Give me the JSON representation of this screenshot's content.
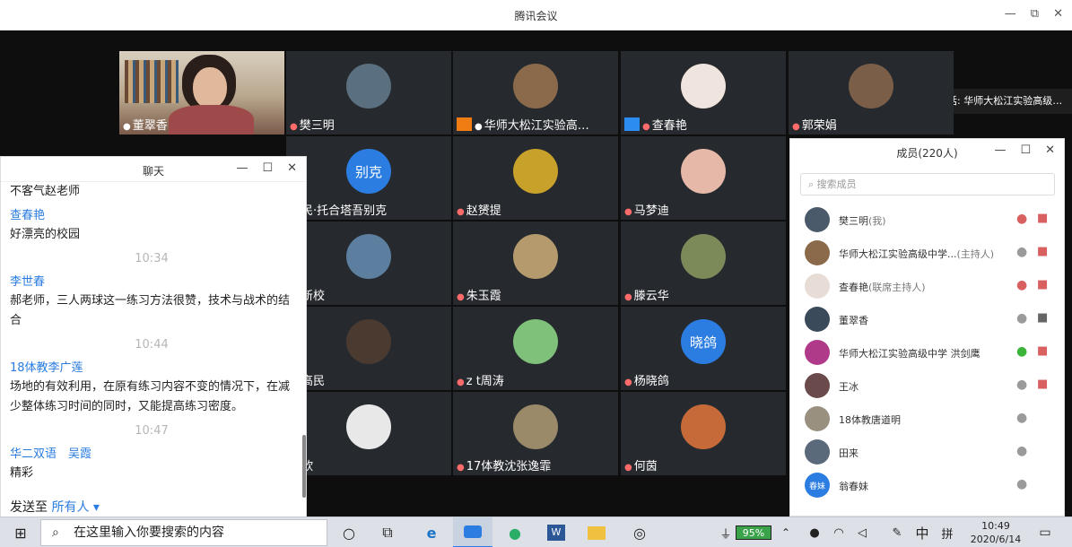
{
  "window": {
    "title": "腾讯会议",
    "minimize": "—",
    "restore": "⧉",
    "close": "✕"
  },
  "speaking": "正在讲话: 华师大松江实验高级…",
  "tiles": [
    {
      "name": "董翠香",
      "mic": "on",
      "color": "#3b3b3b",
      "avatar": "",
      "kind": "camera"
    },
    {
      "name": "樊三明",
      "mic": "off",
      "color": "#5a7080",
      "avatar": ""
    },
    {
      "name": "华师大松江实验高…",
      "mic": "on",
      "color": "#8a6a4a",
      "avatar": "",
      "badge": "host"
    },
    {
      "name": "查春艳",
      "mic": "off",
      "color": "#f0e4de",
      "avatar": "",
      "badge": "cohost"
    },
    {
      "name": "郭荣娟",
      "mic": "off",
      "color": "#7a5e48",
      "avatar": ""
    },
    {
      "name": "赛民·托合塔吾别克",
      "mic": "none",
      "color": "#2b7de1",
      "avatar": "别克"
    },
    {
      "name": "赵赟提",
      "mic": "off",
      "color": "#c7a12a",
      "avatar": ""
    },
    {
      "name": "马梦迪",
      "mic": "off",
      "color": "#e6b8a8",
      "avatar": ""
    },
    {
      "name": "东新校",
      "mic": "none",
      "color": "#5c7fa0",
      "avatar": ""
    },
    {
      "name": "朱玉霞",
      "mic": "off",
      "color": "#b59a6e",
      "avatar": ""
    },
    {
      "name": "滕云华",
      "mic": "off",
      "color": "#7c8a5a",
      "avatar": ""
    },
    {
      "name": "张高民",
      "mic": "none",
      "color": "#4a3a30",
      "avatar": ""
    },
    {
      "name": "z t周涛",
      "mic": "off",
      "color": "#7fc07a",
      "avatar": ""
    },
    {
      "name": "杨晓鸽",
      "mic": "off",
      "color": "#2b7de1",
      "avatar": "晓鸽"
    },
    {
      "name": "崔欣",
      "mic": "none",
      "color": "#e8e8e8",
      "avatar": ""
    },
    {
      "name": "17体教沈张逸霏",
      "mic": "off",
      "color": "#9a8a6a",
      "avatar": ""
    },
    {
      "name": "何茵",
      "mic": "off",
      "color": "#c66a3a",
      "avatar": ""
    }
  ],
  "chat": {
    "title": "聊天",
    "messages": [
      {
        "type": "text",
        "text": "不客气赵老师"
      },
      {
        "type": "sender",
        "text": "查春艳"
      },
      {
        "type": "text",
        "text": "好漂亮的校园"
      },
      {
        "type": "time",
        "text": "10:34"
      },
      {
        "type": "sender",
        "text": "李世春"
      },
      {
        "type": "text",
        "text": "郝老师，三人两球这一练习方法很赞，技术与战术的结合"
      },
      {
        "type": "time",
        "text": "10:44"
      },
      {
        "type": "sender",
        "text": "18体教李广莲"
      },
      {
        "type": "text",
        "text": "场地的有效利用，在原有练习内容不变的情况下，在减少整体练习时间的同时，又能提高练习密度。"
      },
      {
        "type": "time",
        "text": "10:47"
      },
      {
        "type": "sender",
        "text": "华二双语　吴霞"
      },
      {
        "type": "text",
        "text": "精彩"
      }
    ],
    "send_label": "发送至",
    "send_target": "所有人 ▾"
  },
  "members": {
    "title": "成员(220人)",
    "search_placeholder": "搜索成员",
    "list": [
      {
        "name": "樊三明",
        "tag": "(我)",
        "mic": "muted",
        "cam": "off",
        "color": "#4a5a6a",
        "avatar": ""
      },
      {
        "name": "华师大松江实验高级中学...",
        "tag": "(主持人)",
        "mic": "on",
        "cam": "off",
        "color": "#8a6a4a",
        "avatar": ""
      },
      {
        "name": "查春艳",
        "tag": "(联席主持人)",
        "mic": "muted",
        "cam": "off",
        "color": "#e8dcd6",
        "avatar": ""
      },
      {
        "name": "董翠香",
        "tag": "",
        "mic": "on",
        "cam": "on",
        "color": "#3a4a5a",
        "avatar": ""
      },
      {
        "name": "华师大松江实验高级中学 洪剑鹰",
        "tag": "",
        "mic": "speaking",
        "cam": "off",
        "color": "#b03a8a",
        "avatar": ""
      },
      {
        "name": "王冰",
        "tag": "",
        "mic": "on",
        "cam": "off",
        "color": "#6a4a4a",
        "avatar": ""
      },
      {
        "name": "18体教唐道明",
        "tag": "",
        "mic": "on",
        "cam": "none",
        "color": "#9a9080",
        "avatar": ""
      },
      {
        "name": "田来",
        "tag": "",
        "mic": "on",
        "cam": "none",
        "color": "#5a6a7a",
        "avatar": ""
      },
      {
        "name": "翁春妹",
        "tag": "",
        "mic": "on",
        "cam": "none",
        "color": "#2b7de1",
        "avatar": "春妹"
      }
    ]
  },
  "taskbar": {
    "start": "⊞",
    "search_text": "在这里输入你要搜索的内容",
    "search_icon": "⌕",
    "battery": "95%",
    "ime": "中",
    "ime2": "拼",
    "time": "10:49",
    "date": "2020/6/14"
  }
}
